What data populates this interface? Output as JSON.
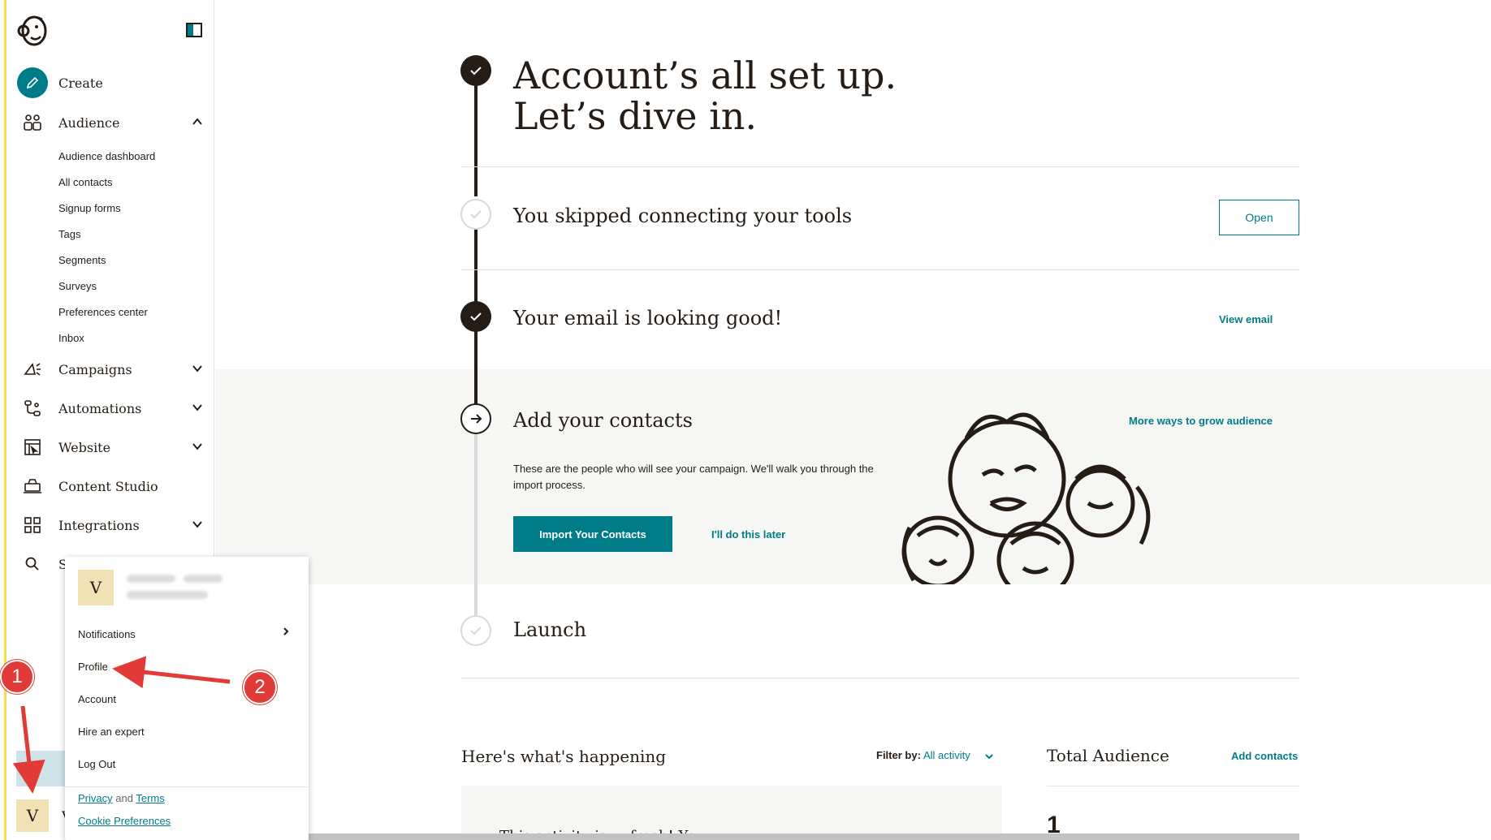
{
  "sidebar": {
    "create_label": "Create",
    "audience_label": "Audience",
    "audience_sub": [
      "Audience dashboard",
      "All contacts",
      "Signup forms",
      "Tags",
      "Segments",
      "Surveys",
      "Preferences center",
      "Inbox"
    ],
    "campaigns_label": "Campaigns",
    "automations_label": "Automations",
    "website_label": "Website",
    "content_studio_label": "Content Studio",
    "integrations_label": "Integrations",
    "search_label_partial": "S",
    "user_initial": "V",
    "user_name_partial": "V"
  },
  "main": {
    "hero_title_line1": "Account’s all set up.",
    "hero_title_line2": "Let’s dive in.",
    "steps": {
      "tools": {
        "title": "You skipped connecting your tools",
        "action": "Open"
      },
      "email": {
        "title": "Your email is looking good!",
        "action": "View email"
      },
      "contacts": {
        "title": "Add your contacts",
        "description": "These are the people who will see your campaign. We'll walk you through the import process.",
        "primary_action": "Import Your Contacts",
        "secondary_action": "I'll do this later",
        "more_link": "More ways to grow audience"
      },
      "launch": {
        "title": "Launch"
      }
    },
    "happening": {
      "title": "Here's what's happening",
      "filter_label": "Filter by:",
      "filter_value": "All activity",
      "activity_text_partial": "This activity is ... fresh! You ..."
    },
    "audience": {
      "title": "Total Audience",
      "action": "Add contacts",
      "count": "1"
    }
  },
  "menu": {
    "avatar_initial": "V",
    "items": [
      "Notifications",
      "Profile",
      "Account",
      "Hire an expert",
      "Log Out"
    ],
    "footer_privacy": "Privacy",
    "footer_and": "and",
    "footer_terms": "Terms",
    "footer_cookie": "Cookie Preferences"
  },
  "annotations": {
    "badge1": "1",
    "badge2": "2"
  },
  "colors": {
    "accent": "#007c89",
    "dark": "#241c15",
    "annotation": "#e23a36",
    "sidebar_rule": "#f4e04d"
  }
}
